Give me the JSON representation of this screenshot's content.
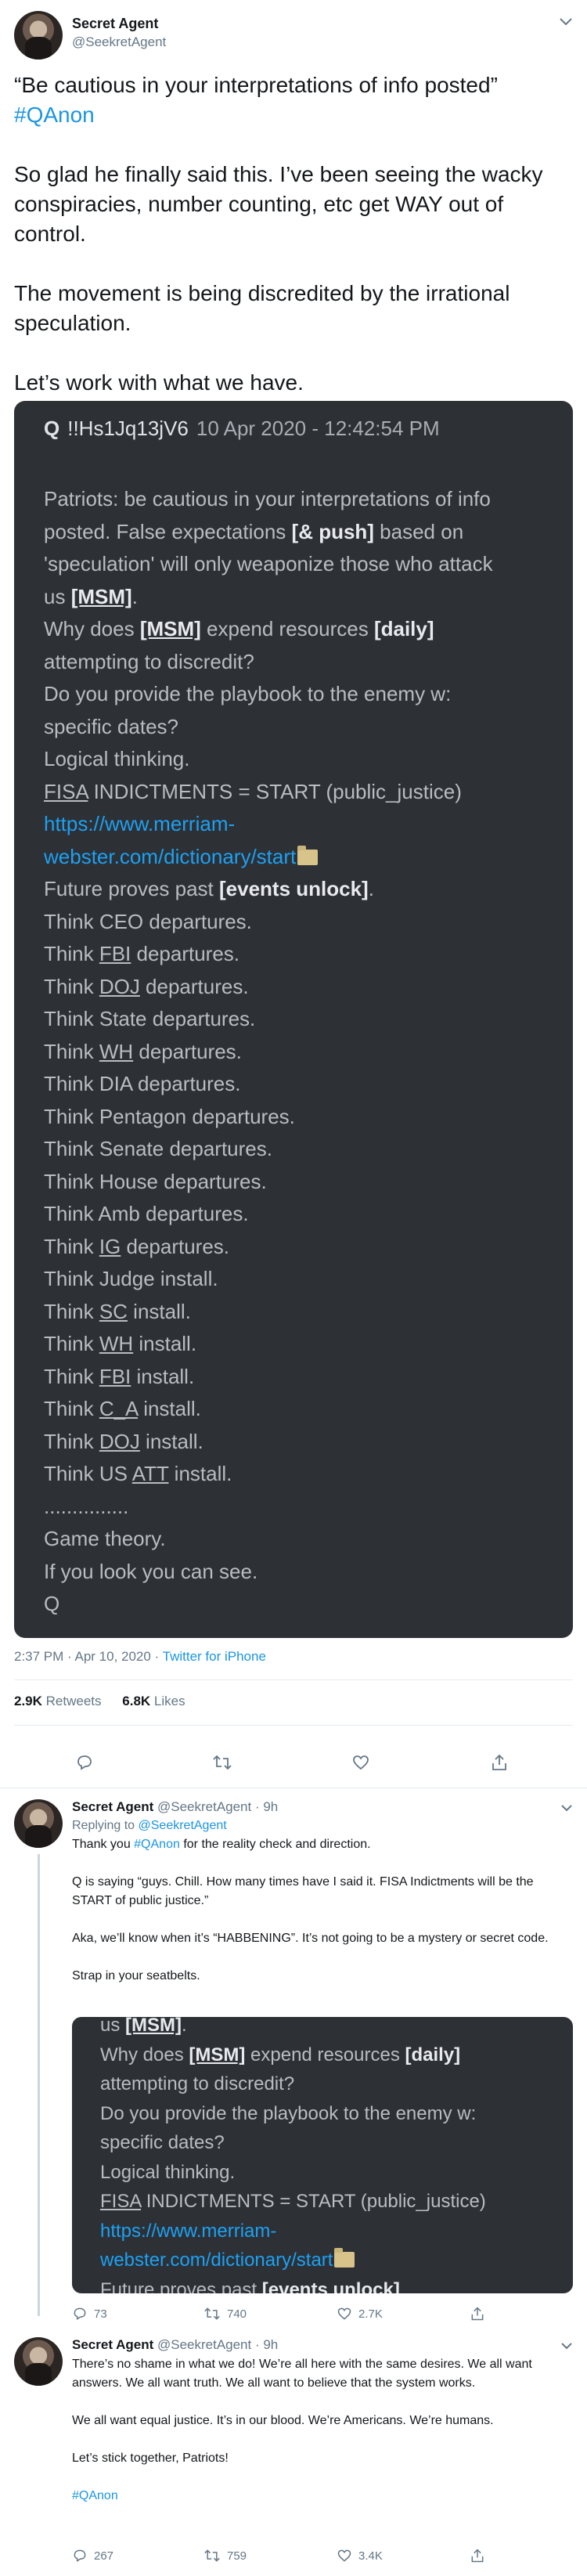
{
  "main_tweet": {
    "author_name": "Secret Agent",
    "author_handle": "@SeekretAgent",
    "body": {
      "line1": "“Be cautious in your interpretations of info posted”",
      "hashtag": "#QAnon",
      "para2": "So glad he finally said this. I’ve been seeing the wacky conspiracies, number counting, etc get WAY out of control.",
      "para3": "The movement is being discredited by the irrational speculation.",
      "para4": "Let’s work with what we have."
    },
    "timestamp": "2:37 PM · Apr 10, 2020 · ",
    "source": "Twitter for iPhone",
    "retweets_count": "2.9K",
    "retweets_label": "Retweets",
    "likes_count": "6.8K",
    "likes_label": "Likes"
  },
  "q_post": {
    "q": "Q",
    "trip": "!!Hs1Jq13jV6",
    "date": "10 Apr 2020 - 12:42:54 PM",
    "intro_a": "Patriots: be cautious in your interpretations of info",
    "intro_b": "posted. False expectations ",
    "intro_b_bold": "[& push]",
    "intro_b_end": " based on",
    "intro_c": "'speculation' will only weaponize those who attack",
    "intro_d_pre": "us ",
    "msm": "[MSM]",
    "intro_d_end": ".",
    "why_pre": "Why does ",
    "why_mid": " expend resources ",
    "daily": "[daily]",
    "attempting": "attempting to discredit?",
    "playbook": "Do you provide the playbook to the enemy w:",
    "specific": "specific dates?",
    "logical": "Logical thinking.",
    "fisa": "FISA",
    "indictments": " INDICTMENTS = START (public_justice)",
    "link1": "https://www.merriam-",
    "link2": "webster.com/dictionary/start",
    "future_pre": "Future proves past ",
    "events": "[events unlock]",
    "future_end": ".",
    "think": "Think ",
    "dep_ceo": "CEO departures.",
    "fbi": "FBI",
    "doj": "DOJ",
    "wh": "WH",
    "ig": "IG",
    "sc": "SC",
    "ca": "C_A",
    "att": "ATT",
    "departures": " departures.",
    "install": " install.",
    "dep_state": "State departures.",
    "dep_dia": "DIA departures.",
    "dep_pentagon": "Pentagon departures.",
    "dep_senate": "Senate departures.",
    "dep_house": "House departures.",
    "dep_amb": "Amb departures.",
    "inst_judge": "Judge install.",
    "inst_us": "US ",
    "dots": "...............",
    "game": "Game theory.",
    "look": "If you look you can see.",
    "sig": "Q"
  },
  "reply1": {
    "author_name": "Secret Agent",
    "author_handle": "@SeekretAgent",
    "time": " · 9h",
    "replying_to_label": "Replying to ",
    "replying_to_handle": "@SeekretAgent",
    "p1_pre": "Thank you ",
    "p1_tag": "#QAnon",
    "p1_end": " for the reality check and direction.",
    "p2": "Q is saying “guys. Chill. How many times have I said it. FISA Indictments will be the START of public justice.”",
    "p3": "Aka, we’ll know when it’s “HABBENING”. It’s not going to be a mystery or secret code.",
    "p4": "Strap in your seatbelts.",
    "replies": "73",
    "retweets": "740",
    "likes": "2.7K"
  },
  "reply1_embed": {
    "future_cut": "Future proves past "
  },
  "reply2": {
    "author_name": "Secret Agent",
    "author_handle": "@SeekretAgent",
    "time": " · 9h",
    "p1": "There’s no shame in what we do!  We’re all here with the same desires.  We all want answers. We all want truth. We all want to believe that the system works.",
    "p2": "We all want equal justice. It’s in our blood. We’re Americans. We’re humans.",
    "p3": "Let’s stick together, Patriots!",
    "tag": "#QAnon",
    "replies": "267",
    "retweets": "759",
    "likes": "3.4K"
  }
}
